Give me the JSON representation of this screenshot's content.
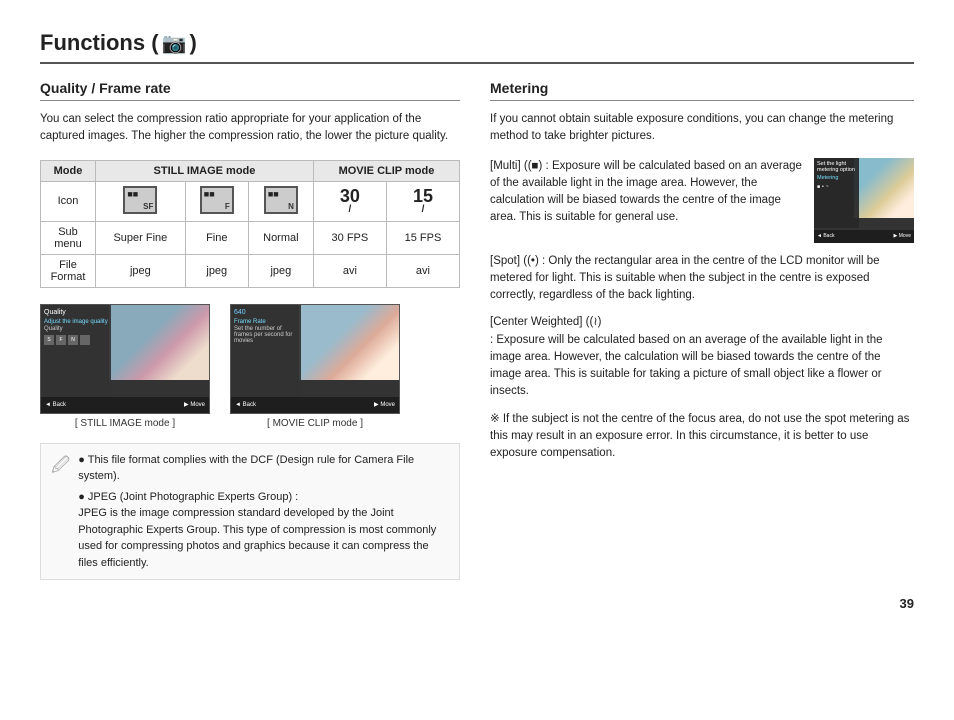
{
  "header": {
    "title": "Functions (",
    "title_end": ")",
    "camera_icon": "📷"
  },
  "left": {
    "section_title": "Quality / Frame rate",
    "intro": "You can select the compression ratio appropriate for your application of the captured images. The higher the compression ratio, the lower the picture quality.",
    "table": {
      "col_headers": [
        "Mode",
        "STILL IMAGE mode",
        "",
        "",
        "MOVIE CLIP mode",
        ""
      ],
      "rows": [
        {
          "label": "Mode",
          "still_header": "STILL IMAGE mode",
          "movie_header": "MOVIE CLIP mode"
        }
      ],
      "icon_row_label": "Icon",
      "submenu_label": "Sub menu",
      "submenu_values": [
        "Super Fine",
        "Fine",
        "Normal",
        "30 FPS",
        "15 FPS"
      ],
      "file_format_label": "File Format",
      "file_format_values": [
        "jpeg",
        "jpeg",
        "jpeg",
        "avi",
        "avi"
      ]
    },
    "screenshots": [
      {
        "caption": "[ STILL IMAGE mode ]",
        "menu_title": "Quality",
        "menu_items": [
          "Adjust the image quality",
          "Quality"
        ]
      },
      {
        "caption": "[ MOVIE CLIP mode ]",
        "menu_title": "Frame Rate",
        "menu_items": [
          "Frame Rate",
          "Set the number of frames per second for movies"
        ]
      }
    ],
    "notes": {
      "note1": "This file format complies with the DCF (Design rule for Camera File system).",
      "note2": "JPEG (Joint Photographic Experts Group) :",
      "note2_detail": "JPEG is the image compression standard developed by the Joint Photographic Experts Group. This type of compression is most commonly used for compressing photos and graphics because it can compress the files efficiently."
    }
  },
  "right": {
    "section_title": "Metering",
    "intro": "If you cannot obtain suitable exposure conditions, you can change the metering method to take brighter pictures.",
    "multi_label": "[Multi] (",
    "multi_label_sym": "■",
    "multi_label_end": ") :",
    "multi_desc": "Exposure will be calculated based on an average of the available light in the image area. However, the calculation will be biased towards the centre of the image area. This is suitable for general use.",
    "multi_menu": "Set the light metering option",
    "multi_menu2": "Metering",
    "spot_label": "[Spot] (",
    "spot_label_sym": "•",
    "spot_label_end": ") :",
    "spot_desc": "Only the rectangular area in the centre of the LCD monitor will be metered for light. This is suitable when the subject in the centre is exposed correctly, regardless of the back lighting.",
    "center_label": "[Center Weighted] (",
    "center_label_sym": "≈",
    "center_label_end": ")",
    "center_desc": ": Exposure will be calculated based on an average of the available light in the image area. However, the calculation will be biased towards the centre of the image area. This is suitable for taking a picture of small object like a flower or insects.",
    "note": "※ If the subject is not the centre of the focus area, do not use the spot metering as this may result in an exposure error. In this circumstance, it is better to use exposure compensation."
  },
  "page_number": "39"
}
